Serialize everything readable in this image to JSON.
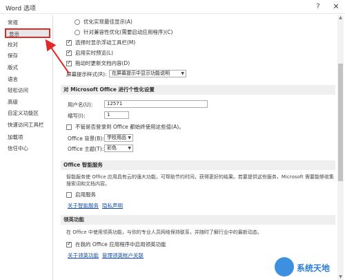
{
  "window": {
    "title": "Word 选项",
    "help": "?",
    "close": "✕"
  },
  "sidebar": {
    "items": [
      {
        "label": "常规"
      },
      {
        "label": "显示"
      },
      {
        "label": "校对"
      },
      {
        "label": "保存"
      },
      {
        "label": "版式"
      },
      {
        "label": "语言"
      },
      {
        "label": "轻松访问"
      },
      {
        "label": "高级"
      },
      {
        "label": "自定义功能区"
      },
      {
        "label": "快速访问工具栏"
      },
      {
        "label": "加载项"
      },
      {
        "label": "信任中心"
      }
    ],
    "selected_index": 1
  },
  "ui_options": {
    "radio1": "优化实现最佳显示(A)",
    "radio2": "针对兼容性优化(需要启动应用程序)(C)",
    "check_minitoolbar": "选择时显示浮动工具栏(M)",
    "check_livepreview": "启用实时预览(L)",
    "check_updatecontent": "拖动时更新文档内容(D)",
    "tooltip_label": "屏幕提示样式(R):",
    "tooltip_value": "在屏幕提示中显示功能说明"
  },
  "personalize": {
    "header": "对 Microsoft Office 进行个性化设置",
    "username_label": "用户名(U):",
    "username_value": "12571",
    "initials_label": "缩写(I):",
    "initials_value": "1",
    "always_use_label": "不管是否登录到 Office 都始终使用这些值(A)。",
    "background_label": "Office 背景(B):",
    "background_value": "学校用品",
    "theme_label": "Office 主题(T):",
    "theme_value": "彩色"
  },
  "intelligent": {
    "header": "Office 智能服务",
    "desc": "智能服务使 Office 应用具有云的强大功能，可帮助节约时间，获得更好的结果。若要提供这些服务，Microsoft 需要能够收集搜索词和文档内容。",
    "enable_label": "启用服务",
    "link_about": "关于智能服务",
    "link_privacy": "隐私声明"
  },
  "linkedin": {
    "header": "领英功能",
    "desc": "在 Office 中使用领英功能，与你的专业人员网络保持联系，并随时了解行业中的最新动态。",
    "enable_label": "在我的 Office 应用程序中启用领英功能",
    "link_about": "关于领英功能",
    "link_manage": "管理领英帐户关联"
  },
  "watermark": {
    "text": "系统天地"
  }
}
